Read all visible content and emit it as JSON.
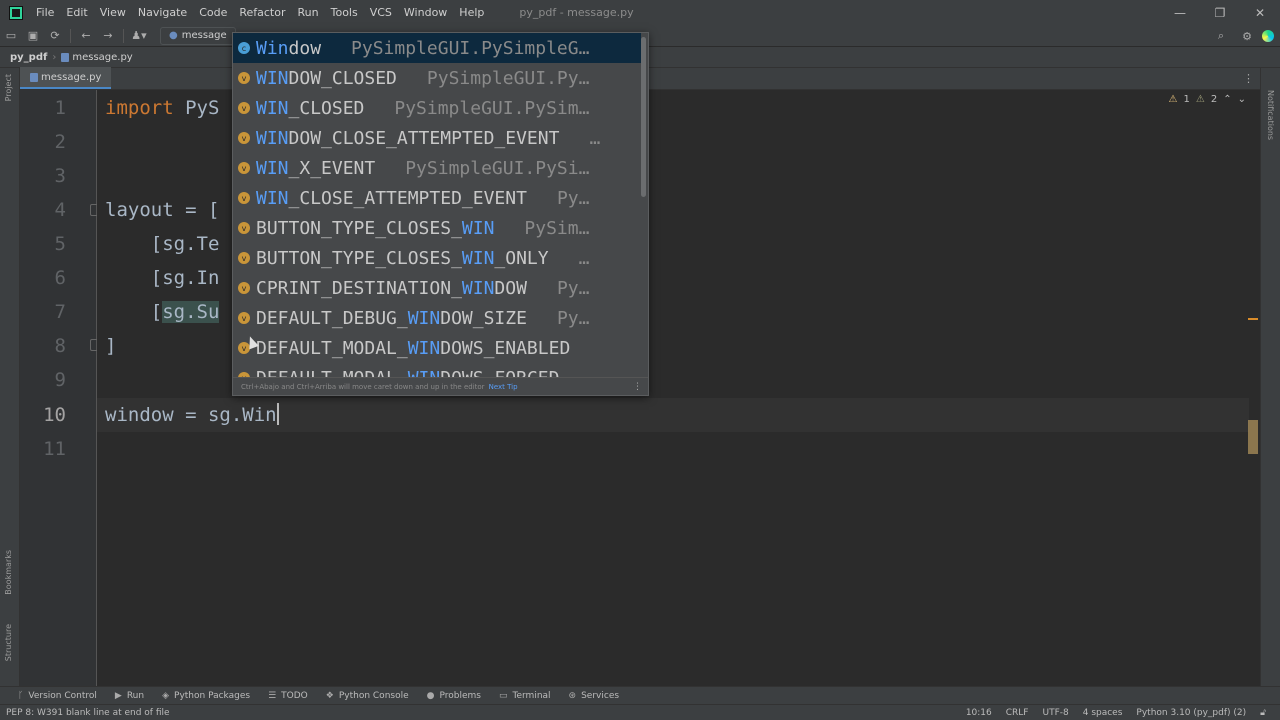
{
  "menubar": {
    "items": [
      "File",
      "Edit",
      "View",
      "Navigate",
      "Code",
      "Refactor",
      "Run",
      "Tools",
      "VCS",
      "Window",
      "Help"
    ],
    "window_title": "py_pdf - message.py",
    "controls": [
      "—",
      "❐",
      "✕"
    ]
  },
  "toolbar": {
    "run_config": "message"
  },
  "breadcrumb": {
    "project": "py_pdf",
    "file": "message.py"
  },
  "left_stripe": {
    "project": "Project",
    "bookmarks": "Bookmarks",
    "structure": "Structure"
  },
  "right_stripe": {
    "notifications": "Notifications"
  },
  "tabs": [
    {
      "label": "message.py",
      "active": true
    }
  ],
  "editor": {
    "inspections": {
      "warnings": "1",
      "weak_warnings": "2"
    },
    "current_line": 10,
    "lines": [
      {
        "num": "1",
        "text": "import PyS"
      },
      {
        "num": "2",
        "text": ""
      },
      {
        "num": "3",
        "text": ""
      },
      {
        "num": "4",
        "text": "layout = ["
      },
      {
        "num": "5",
        "text": "    [sg.Te"
      },
      {
        "num": "6",
        "text": "    [sg.In"
      },
      {
        "num": "7",
        "text": "    [sg.Su"
      },
      {
        "num": "8",
        "text": "]"
      },
      {
        "num": "9",
        "text": ""
      },
      {
        "num": "10",
        "text": "window = sg.Win"
      },
      {
        "num": "11",
        "text": ""
      }
    ]
  },
  "completion": {
    "items": [
      {
        "kind": "c",
        "pre": "",
        "match": "Win",
        "post": "dow",
        "type": "PySimpleGUI.PySimpleG…",
        "selected": true
      },
      {
        "kind": "v",
        "pre": "",
        "match": "WIN",
        "post": "DOW_CLOSED",
        "type": "PySimpleGUI.Py…"
      },
      {
        "kind": "v",
        "pre": "",
        "match": "WIN",
        "post": "_CLOSED",
        "type": "PySimpleGUI.PySim…"
      },
      {
        "kind": "v",
        "pre": "",
        "match": "WIN",
        "post": "DOW_CLOSE_ATTEMPTED_EVENT",
        "type": "…"
      },
      {
        "kind": "v",
        "pre": "",
        "match": "WIN",
        "post": "_X_EVENT",
        "type": "PySimpleGUI.PySi…"
      },
      {
        "kind": "v",
        "pre": "",
        "match": "WIN",
        "post": "_CLOSE_ATTEMPTED_EVENT",
        "type": "Py…"
      },
      {
        "kind": "v",
        "pre": "BUTTON_TYPE_CLOSES_",
        "match": "WIN",
        "post": "",
        "type": "PySim…"
      },
      {
        "kind": "v",
        "pre": "BUTTON_TYPE_CLOSES_",
        "match": "WIN",
        "post": "_ONLY",
        "type": "…"
      },
      {
        "kind": "v",
        "pre": "CPRINT_DESTINATION_",
        "match": "WIN",
        "post": "DOW",
        "type": "Py…"
      },
      {
        "kind": "v",
        "pre": "DEFAULT_DEBUG_",
        "match": "WIN",
        "post": "DOW_SIZE",
        "type": "Py…"
      },
      {
        "kind": "v",
        "pre": "DEFAULT_MODAL_",
        "match": "WIN",
        "post": "DOWS_ENABLED",
        "type": ""
      },
      {
        "kind": "v",
        "pre": "DEFAULT_MODAL_",
        "match": "WIN",
        "post": "DOWS_FORCED",
        "type": ""
      }
    ],
    "footer_text": "Ctrl+Abajo and Ctrl+Arriba will move caret down and up in the editor",
    "footer_link": "Next Tip"
  },
  "tool_windows": [
    {
      "icon": "ᚴ",
      "label": "Version Control"
    },
    {
      "icon": "▶",
      "label": "Run"
    },
    {
      "icon": "◈",
      "label": "Python Packages"
    },
    {
      "icon": "☰",
      "label": "TODO"
    },
    {
      "icon": "❖",
      "label": "Python Console"
    },
    {
      "icon": "●",
      "label": "Problems"
    },
    {
      "icon": "▭",
      "label": "Terminal"
    },
    {
      "icon": "⊛",
      "label": "Services"
    }
  ],
  "statusbar": {
    "message": "PEP 8: W391 blank line at end of file",
    "position": "10:16",
    "line_sep": "CRLF",
    "encoding": "UTF-8",
    "indent": "4 spaces",
    "interpreter": "Python 3.10 (py_pdf) (2)"
  },
  "colors": {
    "background": "#2b2b2b",
    "chrome": "#3c3f41",
    "keyword": "#cc7832",
    "match": "#589df6",
    "selection": "#0d293e"
  }
}
